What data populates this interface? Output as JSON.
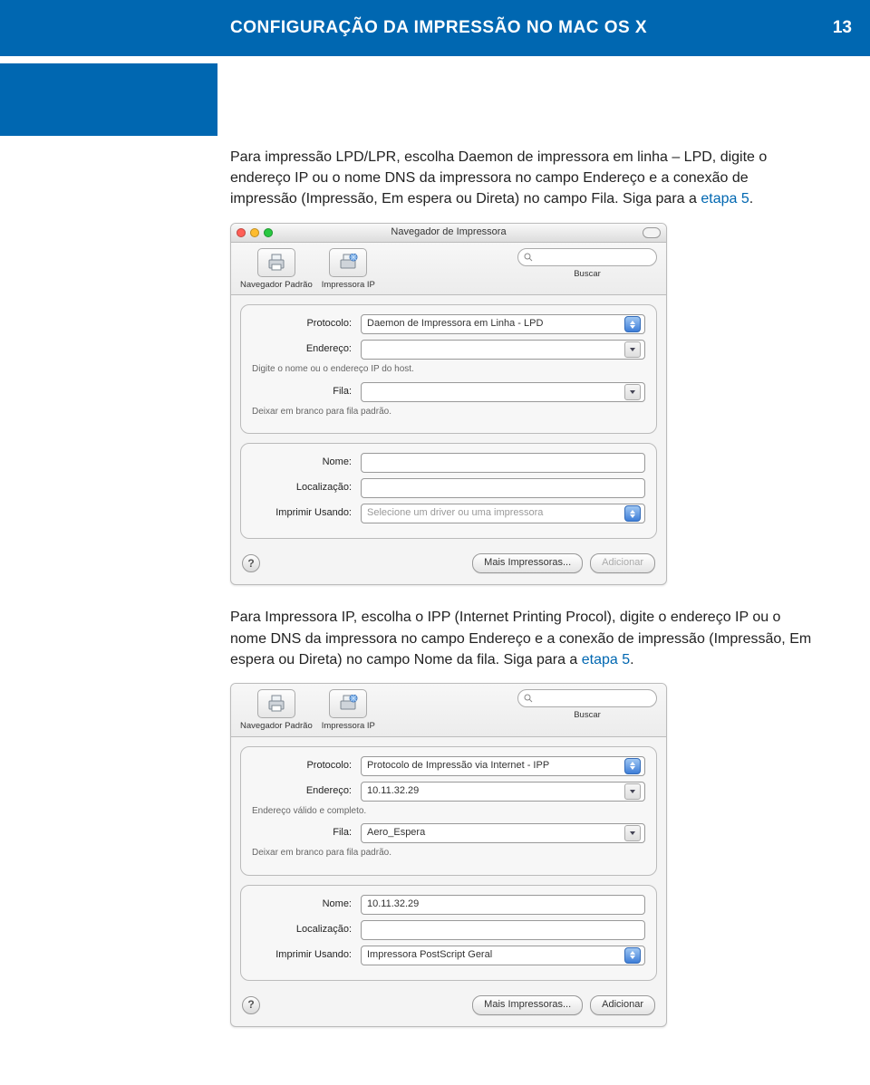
{
  "header": {
    "title": "CONFIGURAÇÃO DA IMPRESSÃO NO MAC OS X",
    "page": "13"
  },
  "para1_a": "Para impressão LPD/LPR, escolha Daemon de impressora em linha – LPD, digite o endereço IP ou o nome DNS da impressora no campo Endereço e a conexão de impressão (Impressão, Em espera ou Direta) no campo Fila. Siga para a ",
  "para1_link": "etapa 5",
  "para1_b": ".",
  "para2_a": "Para Impressora IP, escolha o IPP (Internet Printing Procol), digite o endereço IP ou o nome DNS da impressora no campo Endereço e a conexão de impressão (Impressão, Em espera ou Direta) no campo Nome da fila. Siga para a ",
  "para2_link": "etapa 5",
  "para2_b": ".",
  "win1": {
    "title": "Navegador de Impressora",
    "toolbar": {
      "browser": "Navegador Padrão",
      "ip": "Impressora IP",
      "search": "Buscar",
      "search_placeholder": ""
    },
    "panelA": {
      "protocol_label": "Protocolo:",
      "protocol_value": "Daemon de Impressora em Linha - LPD",
      "address_label": "Endereço:",
      "address_value": "",
      "address_hint": "Digite o nome ou o endereço IP do host.",
      "queue_label": "Fila:",
      "queue_value": "",
      "queue_hint": "Deixar em branco para fila padrão."
    },
    "panelB": {
      "name_label": "Nome:",
      "name_value": "",
      "location_label": "Localização:",
      "location_value": "",
      "using_label": "Imprimir Usando:",
      "using_value": "Selecione um driver ou uma impressora"
    },
    "footer": {
      "more": "Mais Impressoras...",
      "add": "Adicionar"
    }
  },
  "win2": {
    "toolbar": {
      "browser": "Navegador Padrão",
      "ip": "Impressora IP",
      "search": "Buscar",
      "search_placeholder": ""
    },
    "panelA": {
      "protocol_label": "Protocolo:",
      "protocol_value": "Protocolo de Impressão via Internet - IPP",
      "address_label": "Endereço:",
      "address_value": "10.11.32.29",
      "address_hint": "Endereço válido e completo.",
      "queue_label": "Fila:",
      "queue_value": "Aero_Espera",
      "queue_hint": "Deixar em branco para fila padrão."
    },
    "panelB": {
      "name_label": "Nome:",
      "name_value": "10.11.32.29",
      "location_label": "Localização:",
      "location_value": "",
      "using_label": "Imprimir Usando:",
      "using_value": "Impressora PostScript Geral"
    },
    "footer": {
      "more": "Mais Impressoras...",
      "add": "Adicionar"
    }
  }
}
